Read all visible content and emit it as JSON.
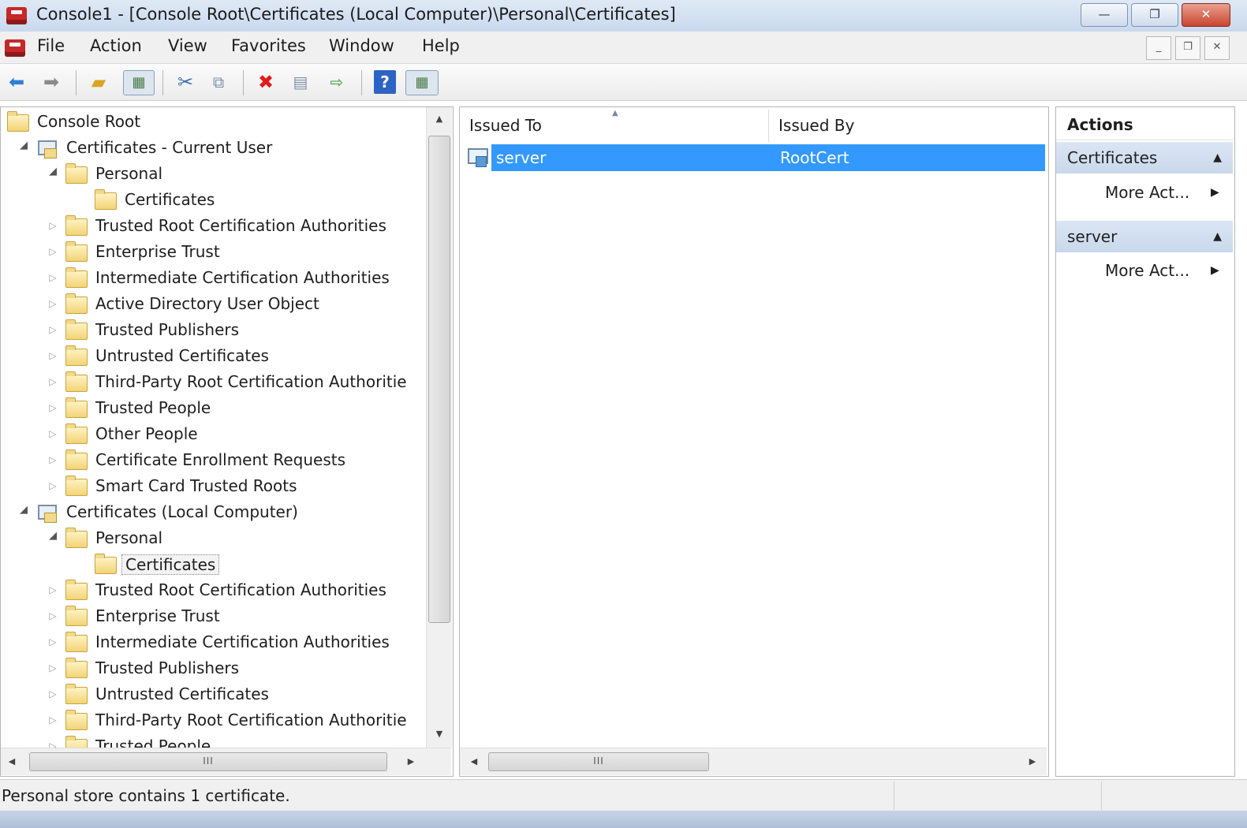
{
  "window": {
    "title": "Console1 - [Console Root\\Certificates (Local Computer)\\Personal\\Certificates]",
    "minimize": "—",
    "restore": "❐",
    "close": "✕"
  },
  "menu": [
    "File",
    "Action",
    "View",
    "Favorites",
    "Window",
    "Help"
  ],
  "mdi": {
    "minimize": "_",
    "restore": "❐",
    "close": "✕"
  },
  "tree": {
    "rows": [
      {
        "label": "Console Root",
        "indent": 0,
        "icon": "folder",
        "expander": "none"
      },
      {
        "label": "Certificates - Current User",
        "indent": 1,
        "icon": "certstore",
        "expander": "open"
      },
      {
        "label": "Personal",
        "indent": 2,
        "icon": "folder",
        "expander": "open"
      },
      {
        "label": "Certificates",
        "indent": 3,
        "icon": "folder",
        "expander": "none"
      },
      {
        "label": "Trusted Root Certification Authorities",
        "indent": 2,
        "icon": "folder",
        "expander": "closed"
      },
      {
        "label": "Enterprise Trust",
        "indent": 2,
        "icon": "folder",
        "expander": "closed"
      },
      {
        "label": "Intermediate Certification Authorities",
        "indent": 2,
        "icon": "folder",
        "expander": "closed"
      },
      {
        "label": "Active Directory User Object",
        "indent": 2,
        "icon": "folder",
        "expander": "closed"
      },
      {
        "label": "Trusted Publishers",
        "indent": 2,
        "icon": "folder",
        "expander": "closed"
      },
      {
        "label": "Untrusted Certificates",
        "indent": 2,
        "icon": "folder",
        "expander": "closed"
      },
      {
        "label": "Third-Party Root Certification Authoritie",
        "indent": 2,
        "icon": "folder",
        "expander": "closed"
      },
      {
        "label": "Trusted People",
        "indent": 2,
        "icon": "folder",
        "expander": "closed"
      },
      {
        "label": "Other People",
        "indent": 2,
        "icon": "folder",
        "expander": "closed"
      },
      {
        "label": "Certificate Enrollment Requests",
        "indent": 2,
        "icon": "folder",
        "expander": "closed"
      },
      {
        "label": "Smart Card Trusted Roots",
        "indent": 2,
        "icon": "folder",
        "expander": "closed"
      },
      {
        "label": "Certificates (Local Computer)",
        "indent": 1,
        "icon": "certstore",
        "expander": "open"
      },
      {
        "label": "Personal",
        "indent": 2,
        "icon": "folder",
        "expander": "open"
      },
      {
        "label": "Certificates",
        "indent": 3,
        "icon": "folder",
        "expander": "none",
        "selected": true
      },
      {
        "label": "Trusted Root Certification Authorities",
        "indent": 2,
        "icon": "folder",
        "expander": "closed"
      },
      {
        "label": "Enterprise Trust",
        "indent": 2,
        "icon": "folder",
        "expander": "closed"
      },
      {
        "label": "Intermediate Certification Authorities",
        "indent": 2,
        "icon": "folder",
        "expander": "closed"
      },
      {
        "label": "Trusted Publishers",
        "indent": 2,
        "icon": "folder",
        "expander": "closed"
      },
      {
        "label": "Untrusted Certificates",
        "indent": 2,
        "icon": "folder",
        "expander": "closed"
      },
      {
        "label": "Third-Party Root Certification Authoritie",
        "indent": 2,
        "icon": "folder",
        "expander": "closed"
      },
      {
        "label": "Trusted People",
        "indent": 2,
        "icon": "folder",
        "expander": "closed"
      }
    ]
  },
  "list": {
    "columns": [
      "Issued To",
      "Issued By"
    ],
    "rows": [
      {
        "issued_to": "server",
        "issued_by": "RootCert"
      }
    ]
  },
  "actions": {
    "title": "Actions",
    "groups": [
      {
        "name": "Certificates",
        "link": "More Act..."
      },
      {
        "name": "server",
        "link": "More Act..."
      }
    ]
  },
  "scroll": {
    "grip": "III"
  },
  "status": {
    "text": "Personal store contains 1 certificate."
  },
  "colors": {
    "selection": "#3399ff",
    "group_header": "#cddbee",
    "folder": "#f2d477"
  }
}
